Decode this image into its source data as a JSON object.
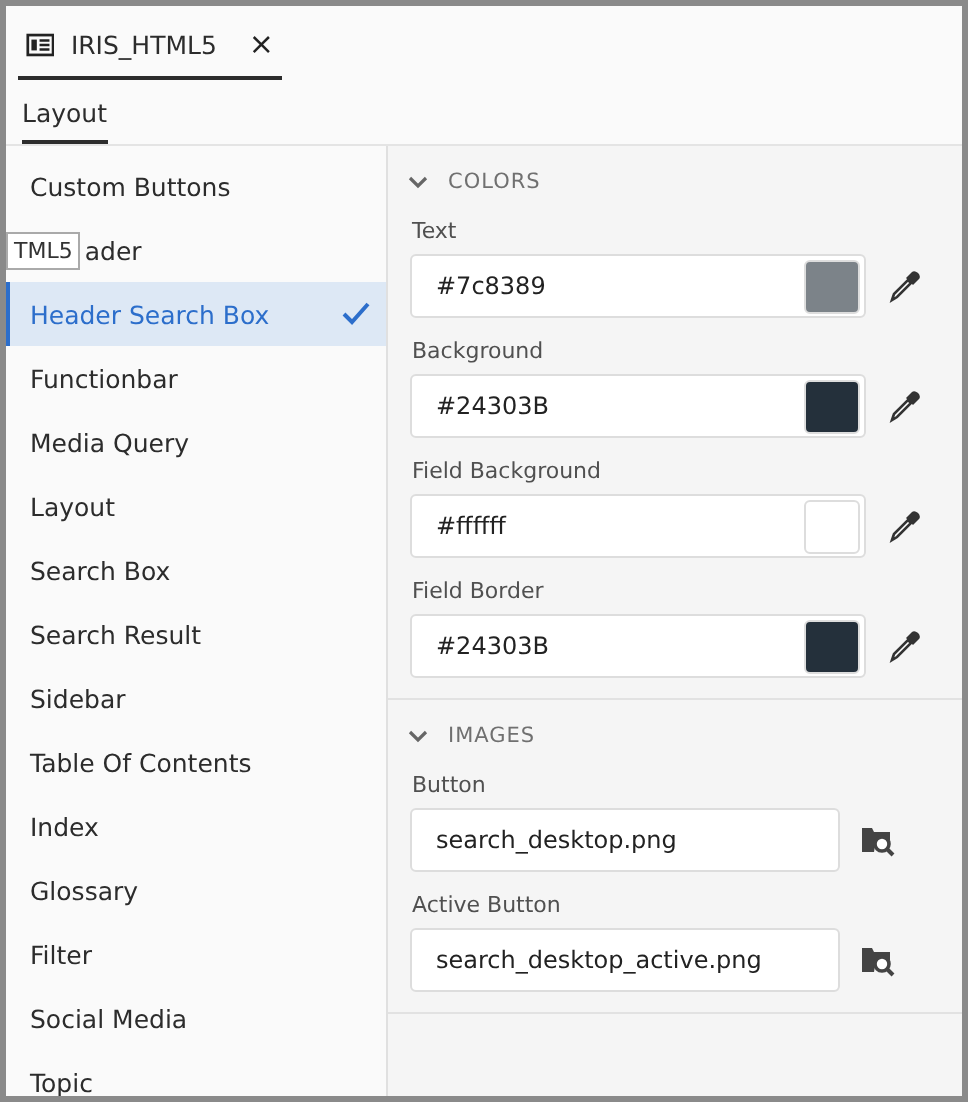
{
  "tab": {
    "title": "IRIS_HTML5",
    "close": "×"
  },
  "subtab": {
    "label": "Layout",
    "selected": true
  },
  "sidebar": {
    "items": [
      {
        "label": "Custom Buttons",
        "selected": false
      },
      {
        "label": "ader",
        "selected": false,
        "tooltip": "TML5"
      },
      {
        "label": "Header Search Box",
        "selected": true
      },
      {
        "label": "Functionbar",
        "selected": false
      },
      {
        "label": "Media Query",
        "selected": false
      },
      {
        "label": "Layout",
        "selected": false
      },
      {
        "label": "Search Box",
        "selected": false
      },
      {
        "label": "Search Result",
        "selected": false
      },
      {
        "label": "Sidebar",
        "selected": false
      },
      {
        "label": "Table Of Contents",
        "selected": false
      },
      {
        "label": "Index",
        "selected": false
      },
      {
        "label": "Glossary",
        "selected": false
      },
      {
        "label": "Filter",
        "selected": false
      },
      {
        "label": "Social Media",
        "selected": false
      },
      {
        "label": "Topic",
        "selected": false
      }
    ]
  },
  "sections": [
    {
      "title": "COLORS",
      "expanded": true,
      "fields": [
        {
          "kind": "color",
          "label": "Text",
          "value": "#7c8389",
          "color": "#7c8389"
        },
        {
          "kind": "color",
          "label": "Background",
          "value": "#24303B",
          "color": "#24303b"
        },
        {
          "kind": "color",
          "label": "Field Background",
          "value": "#ffffff",
          "color": "#ffffff"
        },
        {
          "kind": "color",
          "label": "Field Border",
          "value": "#24303B",
          "color": "#24303b"
        }
      ]
    },
    {
      "title": "IMAGES",
      "expanded": true,
      "fields": [
        {
          "kind": "file",
          "label": "Button",
          "value": "search_desktop.png"
        },
        {
          "kind": "file",
          "label": "Active Button",
          "value": "search_desktop_active.png"
        }
      ]
    }
  ]
}
